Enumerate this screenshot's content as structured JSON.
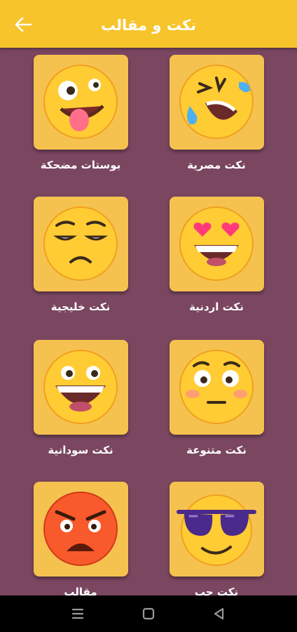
{
  "header": {
    "title": "نكت و مقالب"
  },
  "categories": [
    {
      "label": "بوستات مضحكة",
      "emoji": "zany-face-icon"
    },
    {
      "label": "نكت مصرية",
      "emoji": "rolling-laughing-face-icon"
    },
    {
      "label": "نكت خليجية",
      "emoji": "unamused-face-icon"
    },
    {
      "label": "نكت اردنية",
      "emoji": "heart-eyes-face-icon"
    },
    {
      "label": "نكت سودانية",
      "emoji": "grinning-face-icon"
    },
    {
      "label": "نكت متنوعة",
      "emoji": "flushed-face-icon"
    },
    {
      "label": "مقالب",
      "emoji": "angry-face-icon"
    },
    {
      "label": "نكت حب",
      "emoji": "sunglasses-face-icon"
    }
  ],
  "colors": {
    "appbar": "#f7c42c",
    "background": "#7a4660",
    "card": "#f6c24f"
  }
}
